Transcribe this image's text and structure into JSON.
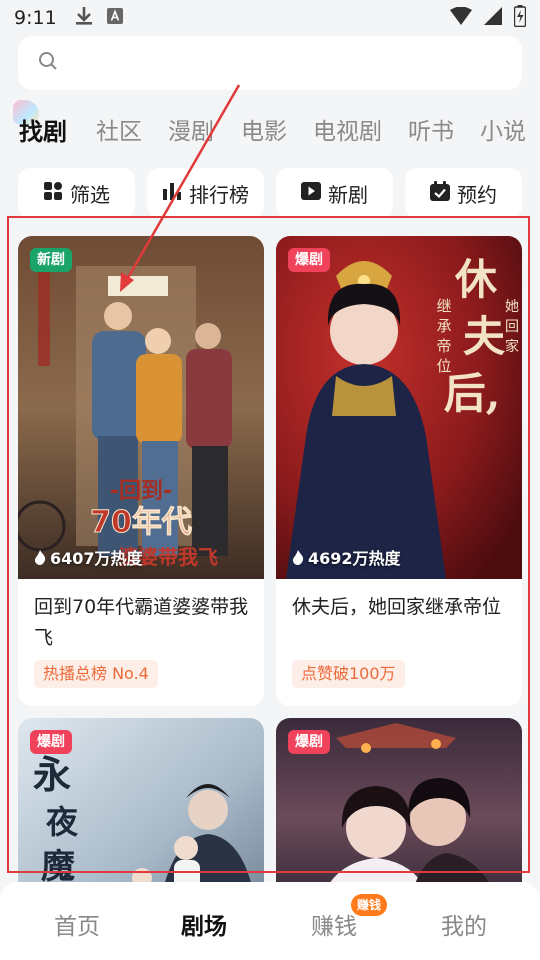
{
  "status_bar": {
    "time": "9:11"
  },
  "search": {
    "placeholder": ""
  },
  "tabs": [
    {
      "label": "找剧",
      "active": true
    },
    {
      "label": "社区"
    },
    {
      "label": "漫剧"
    },
    {
      "label": "电影"
    },
    {
      "label": "电视剧"
    },
    {
      "label": "听书"
    },
    {
      "label": "小说"
    }
  ],
  "filters": [
    {
      "label": "筛选",
      "icon": "grid-icon"
    },
    {
      "label": "排行榜",
      "icon": "bar-chart-icon"
    },
    {
      "label": "新剧",
      "icon": "play-icon"
    },
    {
      "label": "预约",
      "icon": "calendar-check-icon"
    }
  ],
  "cards": [
    {
      "badge": "新剧",
      "poster_text": "回到 70年代 霸道婆婆带我飞",
      "heat": "6407万热度",
      "title": "回到70年代霸道婆婆带我飞",
      "tag": "热播总榜 No.4"
    },
    {
      "badge": "爆剧",
      "poster_text": "休夫后，她回家继承帝位",
      "heat": "4692万热度",
      "title": "休夫后，她回家继承帝位",
      "tag": "点赞破100万"
    },
    {
      "badge": "爆剧",
      "poster_text": "永夜魔尊"
    },
    {
      "badge": "爆剧"
    }
  ],
  "bottom_nav": [
    {
      "label": "首页"
    },
    {
      "label": "剧场",
      "active": true
    },
    {
      "label": "赚钱",
      "badge": "赚钱"
    },
    {
      "label": "我的"
    }
  ],
  "colors": {
    "highlight_red": "#e03a3a",
    "new_badge": "#1aa46a",
    "hot_badge": "#f0425a",
    "tag_text": "#ef6a3a"
  }
}
